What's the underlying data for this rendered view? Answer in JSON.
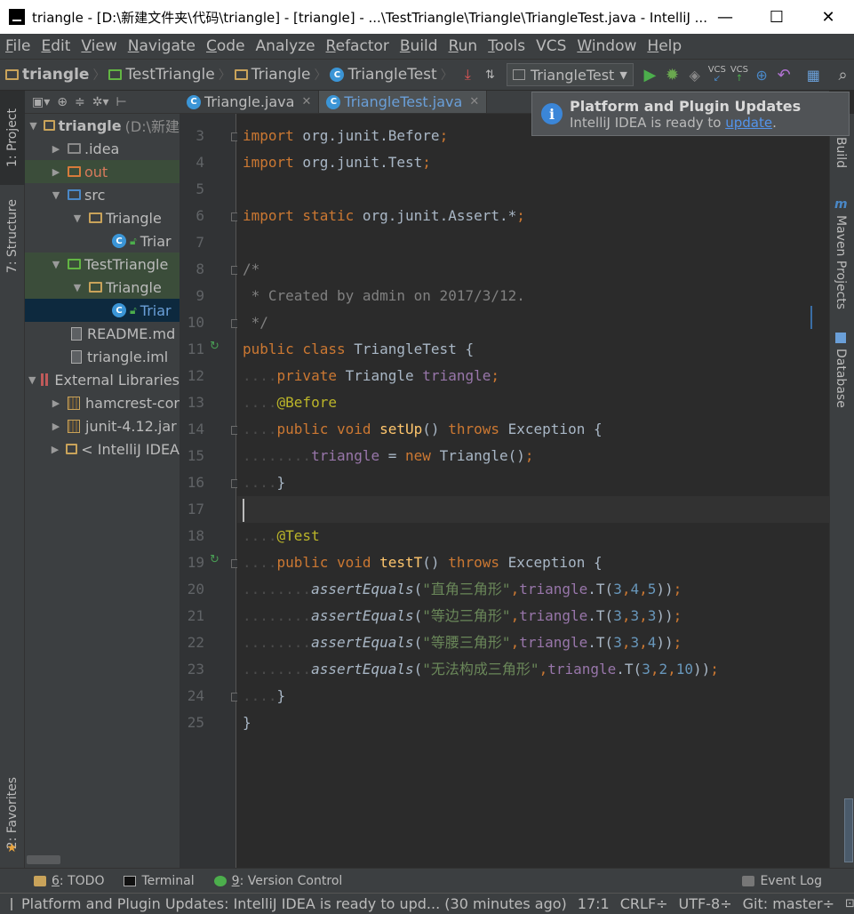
{
  "window": {
    "title": "triangle - [D:\\新建文件夹\\代码\\triangle] - [triangle] - ...\\TestTriangle\\Triangle\\TriangleTest.java - IntelliJ ...",
    "minimize": "—",
    "maximize": "☐",
    "close": "✕"
  },
  "menu": [
    {
      "u": "F",
      "rest": "ile"
    },
    {
      "u": "E",
      "rest": "dit"
    },
    {
      "u": "V",
      "rest": "iew"
    },
    {
      "u": "N",
      "rest": "avigate"
    },
    {
      "u": "C",
      "rest": "ode"
    },
    {
      "u": "",
      "rest": "Analyze"
    },
    {
      "u": "R",
      "rest": "efactor"
    },
    {
      "u": "B",
      "rest": "uild"
    },
    {
      "u": "R",
      "rest": "un"
    },
    {
      "u": "T",
      "rest": "ools"
    },
    {
      "u": "",
      "rest": "VCS"
    },
    {
      "u": "W",
      "rest": "indow"
    },
    {
      "u": "H",
      "rest": "elp"
    }
  ],
  "breadcrumbs": {
    "project": "triangle",
    "module": "TestTriangle",
    "package": "Triangle",
    "class": "TriangleTest"
  },
  "toolbar": {
    "run_config": "TriangleTest",
    "vcs": "VCS"
  },
  "side_tabs": {
    "project": "1: Project",
    "structure": "7: Structure",
    "favorites": "2: Favorites",
    "ant_build": "t Build",
    "maven": "Maven Projects",
    "database": "Database"
  },
  "project_tree": {
    "root": "triangle",
    "root_path": "(D:\\新建",
    "idea": ".idea",
    "out": "out",
    "src": "src",
    "src_pkg": "Triangle",
    "src_class": "Triar",
    "test_module": "TestTriangle",
    "test_pkg": "Triangle",
    "test_class": "Triar",
    "readme": "README.md",
    "iml": "triangle.iml",
    "ext_libs": "External Libraries",
    "lib_hamcrest": "hamcrest-cor",
    "lib_junit": "junit-4.12.jar",
    "lib_jdk": "< IntelliJ IDEA"
  },
  "tabs": [
    {
      "label": "Triangle.java"
    },
    {
      "label": "TriangleTest.java"
    }
  ],
  "notification": {
    "title": "Platform and Plugin Updates",
    "text": "IntelliJ IDEA is ready to ",
    "link": "update",
    "tail": "."
  },
  "line_numbers": [
    "3",
    "4",
    "5",
    "6",
    "7",
    "8",
    "9",
    "10",
    "11",
    "12",
    "13",
    "14",
    "15",
    "16",
    "17",
    "18",
    "19",
    "20",
    "21",
    "22",
    "23",
    "24",
    "25"
  ],
  "code": {
    "l3a": "import",
    "l3b": " org.junit.Before",
    "l3c": ";",
    "l4a": "import",
    "l4b": " org.junit.Test",
    "l4c": ";",
    "l6a": "import static",
    "l6b": " org.junit.Assert.*",
    "l6c": ";",
    "l8": "/*",
    "l9": " * Created by admin on 2017/3/12.",
    "l10": " */",
    "l11a": "public class",
    "l11b": " TriangleTest {",
    "l12ws": "....",
    "l12a": "private",
    "l12b": " Triangle ",
    "l12c": "triangle",
    "l12d": ";",
    "l13ws": "....",
    "l13a": "@Before",
    "l14ws": "....",
    "l14a": "public void",
    "l14b": " setUp",
    "l14c": "() ",
    "l14d": "throws",
    "l14e": " Exception {",
    "l15ws": "........",
    "l15a": "triangle",
    "l15b": " = ",
    "l15c": "new",
    "l15d": " Triangle()",
    "l15e": ";",
    "l16ws": "....",
    "l16a": "}",
    "l18ws": "....",
    "l18a": "@Test",
    "l19ws": "....",
    "l19a": "public void",
    "l19b": " testT",
    "l19c": "() ",
    "l19d": "throws",
    "l19e": " Exception {",
    "l20ws": "........",
    "l20a": "assertEquals",
    "l20b": "(",
    "l20c": "\"直角三角形\"",
    "l20d": ",",
    "l20e": "triangle",
    "l20f": ".T(",
    "l20g": "3",
    "l20h": ",",
    "l20i": "4",
    "l20j": ",",
    "l20k": "5",
    "l20l": "))",
    "l20m": ";",
    "l21ws": "........",
    "l21a": "assertEquals",
    "l21b": "(",
    "l21c": "\"等边三角形\"",
    "l21d": ",",
    "l21e": "triangle",
    "l21f": ".T(",
    "l21g": "3",
    "l21h": ",",
    "l21i": "3",
    "l21j": ",",
    "l21k": "3",
    "l21l": "))",
    "l21m": ";",
    "l22ws": "........",
    "l22a": "assertEquals",
    "l22b": "(",
    "l22c": "\"等腰三角形\"",
    "l22d": ",",
    "l22e": "triangle",
    "l22f": ".T(",
    "l22g": "3",
    "l22h": ",",
    "l22i": "3",
    "l22j": ",",
    "l22k": "4",
    "l22l": "))",
    "l22m": ";",
    "l23ws": "........",
    "l23a": "assertEquals",
    "l23b": "(",
    "l23c": "\"无法构成三角形\"",
    "l23d": ",",
    "l23e": "triangle",
    "l23f": ".T(",
    "l23g": "3",
    "l23h": ",",
    "l23i": "2",
    "l23j": ",",
    "l23k": "10",
    "l23l": "))",
    "l23m": ";",
    "l24ws": "....",
    "l24a": "}",
    "l25a": "}"
  },
  "bottom_tools": {
    "todo_num": "6",
    "todo": ": TODO",
    "terminal": "Terminal",
    "vc_num": "9",
    "vc": ": Version Control",
    "event_log": "Event Log"
  },
  "status": {
    "message": "Platform and Plugin Updates: IntelliJ IDEA is ready to upd... (30 minutes ago)",
    "position": "17:1",
    "line_sep": "CRLF÷",
    "encoding": "UTF-8÷",
    "vcs": "Git: master÷"
  },
  "colors": {
    "keyword": "#cc7832",
    "string": "#6a8759",
    "number": "#6897bb",
    "field": "#9876aa",
    "method": "#ffc66d",
    "annotation": "#bbb529",
    "comment": "#808080"
  }
}
